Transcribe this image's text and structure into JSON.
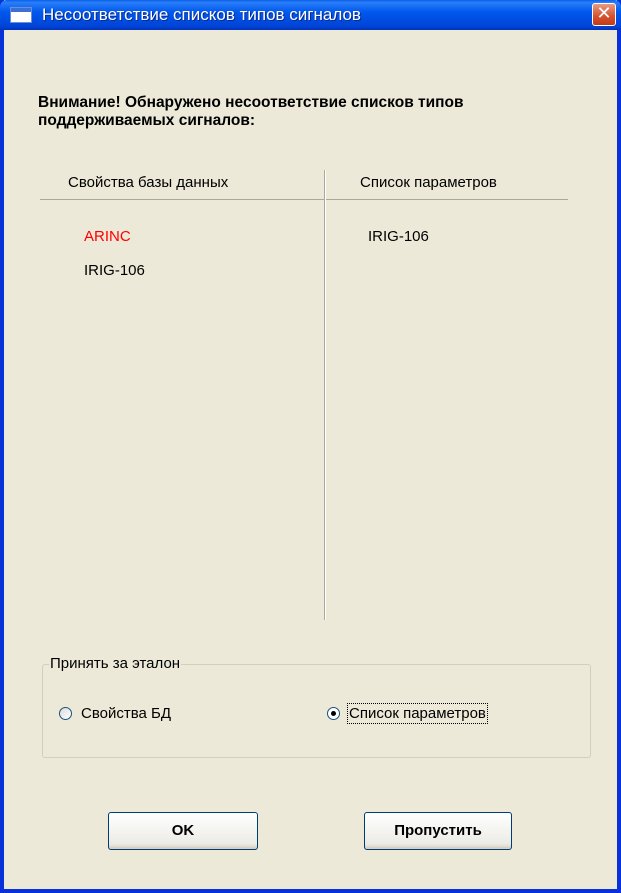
{
  "window": {
    "title": "Несоответствие списков типов сигналов",
    "close_symbol": "✕"
  },
  "message": {
    "line1": "Внимание! Обнаружено несоответствие списков типов",
    "line2": "поддерживаемых сигналов:"
  },
  "left_column": {
    "header": "Свойства базы данных",
    "items": [
      {
        "label": "ARINC",
        "color": "#ff0000"
      },
      {
        "label": "IRIG-106",
        "color": "#000000"
      }
    ]
  },
  "right_column": {
    "header": "Список параметров",
    "items": [
      {
        "label": "IRIG-106",
        "color": "#000000"
      }
    ]
  },
  "reference_group": {
    "legend": "Принять за эталон",
    "options": [
      {
        "label": "Свойства БД",
        "checked": false
      },
      {
        "label": "Список параметров",
        "checked": true
      }
    ]
  },
  "buttons": {
    "ok": "OK",
    "skip": "Пропустить"
  },
  "colors": {
    "titlebar": "#0054e3",
    "window_bg": "#ece9d8",
    "mismatch": "#ff0000"
  }
}
